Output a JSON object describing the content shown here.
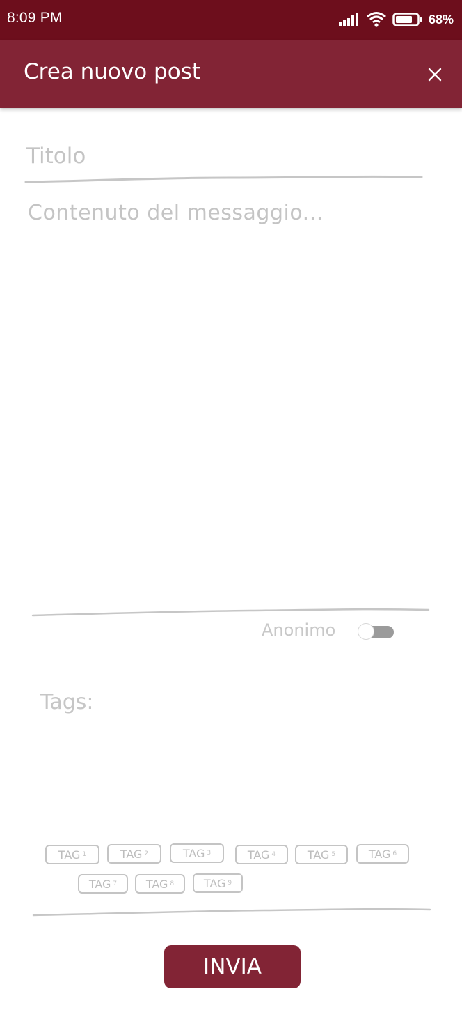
{
  "status_bar": {
    "time": "8:09 PM",
    "battery_percent": "68%",
    "icons": [
      "signal-icon",
      "wifi-icon",
      "battery-icon"
    ]
  },
  "app_bar": {
    "title": "Crea nuovo post",
    "close_icon": "close-icon"
  },
  "form": {
    "title_placeholder": "Titolo",
    "content_placeholder": "Contenuto del messaggio...",
    "anonymous_label": "Anonimo",
    "anonymous_enabled": false,
    "tags_label": "Tags:",
    "tags": [
      {
        "label": "TAG",
        "num": "1"
      },
      {
        "label": "TAG",
        "num": "2"
      },
      {
        "label": "TAG",
        "num": "3"
      },
      {
        "label": "TAG",
        "num": "4"
      },
      {
        "label": "TAG",
        "num": "5"
      },
      {
        "label": "TAG",
        "num": "6"
      },
      {
        "label": "TAG",
        "num": "7"
      },
      {
        "label": "TAG",
        "num": "8"
      },
      {
        "label": "TAG",
        "num": "9"
      }
    ],
    "submit_label": "INVIA"
  },
  "colors": {
    "status_bar": "#6d0e1c",
    "primary": "#822435",
    "placeholder": "#c4c4c4"
  }
}
